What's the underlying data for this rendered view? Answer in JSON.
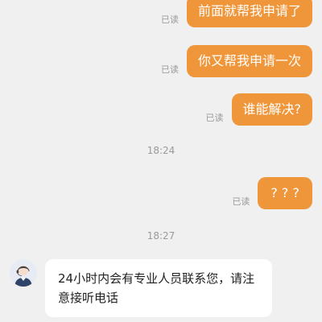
{
  "messages_out": [
    {
      "text": "前面就帮我申请了",
      "status": "已读"
    },
    {
      "text": "你又帮我申请一次",
      "status": "已读"
    },
    {
      "text": "谁能解决?",
      "status": "已读"
    },
    {
      "text": "? ? ?",
      "status": "已读"
    }
  ],
  "timestamps": [
    "18:24",
    "18:27"
  ],
  "incoming": {
    "avatar": "agent-avatar-icon",
    "text": "24小时内会有专业人员联系您，请注意接听电话"
  },
  "colors": {
    "outgoing_bubble": "#f0963a",
    "incoming_bubble": "#ffffff",
    "background": "#f0f0f0"
  }
}
